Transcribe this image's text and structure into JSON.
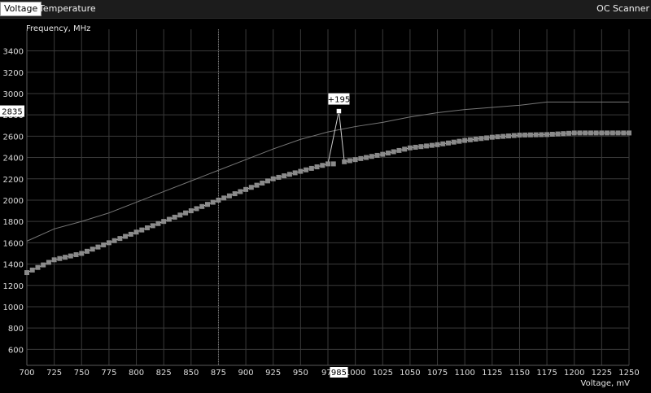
{
  "tabs": {
    "voltage": "Voltage",
    "temperature": "Temperature"
  },
  "header": {
    "oc_scanner": "OC Scanner"
  },
  "axes": {
    "y_title": "Frequency, MHz",
    "x_title": "Voltage, mV"
  },
  "chart_data": {
    "type": "line",
    "xlabel": "Voltage, mV",
    "ylabel": "Frequency, MHz",
    "xlim": [
      700,
      1250
    ],
    "ylim": [
      600,
      3400
    ],
    "xticks": [
      700,
      725,
      750,
      775,
      800,
      825,
      850,
      875,
      900,
      925,
      950,
      975,
      1000,
      1025,
      1050,
      1075,
      1100,
      1125,
      1150,
      1175,
      1200,
      1225,
      1250
    ],
    "yticks": [
      600,
      800,
      1000,
      1200,
      1400,
      1600,
      1800,
      2000,
      2200,
      2400,
      2600,
      2800,
      3000,
      3200,
      3400
    ],
    "grid": true,
    "series": [
      {
        "role": "upper",
        "color": "#777777",
        "x": [
          700,
          725,
          750,
          775,
          800,
          825,
          850,
          875,
          900,
          925,
          950,
          975,
          1000,
          1025,
          1050,
          1075,
          1100,
          1125,
          1150,
          1175,
          1200,
          1225,
          1250
        ],
        "y": [
          1615,
          1730,
          1800,
          1880,
          1980,
          2080,
          2180,
          2280,
          2380,
          2480,
          2570,
          2640,
          2690,
          2730,
          2780,
          2820,
          2850,
          2870,
          2890,
          2920,
          2920,
          2920,
          2920
        ]
      },
      {
        "role": "curve",
        "color": "#7e7e7e",
        "x": [
          700,
          725,
          750,
          775,
          800,
          825,
          850,
          875,
          900,
          925,
          950,
          975,
          985,
          990,
          1000,
          1025,
          1050,
          1075,
          1100,
          1125,
          1150,
          1175,
          1200,
          1225,
          1250
        ],
        "y": [
          1320,
          1440,
          1500,
          1600,
          1700,
          1800,
          1900,
          2000,
          2100,
          2200,
          2270,
          2340,
          2835,
          2360,
          2380,
          2430,
          2490,
          2520,
          2560,
          2590,
          2610,
          2615,
          2630,
          2630,
          2630
        ]
      }
    ],
    "points_x": [
      700,
      705,
      710,
      715,
      720,
      725,
      730,
      735,
      740,
      745,
      750,
      755,
      760,
      765,
      770,
      775,
      780,
      785,
      790,
      795,
      800,
      805,
      810,
      815,
      820,
      825,
      830,
      835,
      840,
      845,
      850,
      855,
      860,
      865,
      870,
      875,
      880,
      885,
      890,
      895,
      900,
      905,
      910,
      915,
      920,
      925,
      930,
      935,
      940,
      945,
      950,
      955,
      960,
      965,
      970,
      975,
      980,
      990,
      995,
      1000,
      1005,
      1010,
      1015,
      1020,
      1025,
      1030,
      1035,
      1040,
      1045,
      1050,
      1055,
      1060,
      1065,
      1070,
      1075,
      1080,
      1085,
      1090,
      1095,
      1100,
      1105,
      1110,
      1115,
      1120,
      1125,
      1130,
      1135,
      1140,
      1145,
      1150,
      1155,
      1160,
      1165,
      1170,
      1175,
      1180,
      1185,
      1190,
      1195,
      1200,
      1205,
      1210,
      1215,
      1220,
      1225,
      1230,
      1235,
      1240,
      1245,
      1250
    ],
    "highlight": {
      "voltage": 985,
      "frequency": 2835,
      "offset_label": "+195",
      "x_readout": "985",
      "y_readout": "2835"
    },
    "guide_x": 875
  },
  "colors": {
    "grid": "#3a3a3a",
    "guide": "#7a7a7a",
    "point": "#8a8a8a",
    "highlight": "#ffffff"
  }
}
